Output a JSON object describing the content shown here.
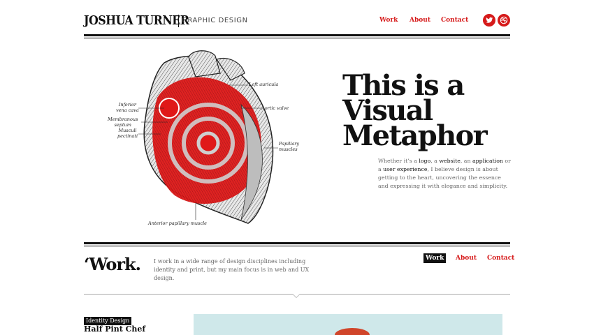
{
  "header": {
    "name": "JOSHUA TURNER",
    "subtitle": "GRAPHIC DESIGN",
    "nav": [
      {
        "label": "Work"
      },
      {
        "label": "About"
      },
      {
        "label": "Contact"
      }
    ],
    "social": [
      {
        "icon": "twitter-bird-icon"
      },
      {
        "icon": "dribbble-ball-icon"
      }
    ]
  },
  "hero": {
    "title_lines": [
      "This is a",
      "Visual",
      "Metaphor"
    ],
    "copy": {
      "p1": "Whether it’s a ",
      "logo": "logo",
      "p2": ", a ",
      "website": "website",
      "p3": ", an ",
      "application": "application",
      "p4": " or a ",
      "ux": "user experience",
      "p5": ", I believe design is about getting to the heart, uncovering the essence and expressing it with elegance and simplicity."
    },
    "heart_labels": {
      "left_auricula": "Left auricula",
      "inferior_vena_cava": "Inferior\nvena cava",
      "aortic_valve": "Aortic valve",
      "membranous_septum": "Membranous\nseptum",
      "musculi_pectinati": "Musculi\npectinati",
      "papillary_muscles": "Papillary\nmuscles",
      "anterior_papillary": "Anterior papillary muscle"
    }
  },
  "work": {
    "heading": "‘Work.",
    "copy": "I work in a wide range of design disciplines including identity and print, but my main focus is in web and UX design.",
    "nav": [
      {
        "label": "Work",
        "active": true
      },
      {
        "label": "About",
        "active": false
      },
      {
        "label": "Contact",
        "active": false
      }
    ]
  },
  "project": {
    "tag": "Identity Design",
    "title": "Half Pint Chef"
  },
  "colors": {
    "accent": "#d61a1a",
    "ink": "#111111",
    "preview_bg": "#cfe8ea"
  }
}
